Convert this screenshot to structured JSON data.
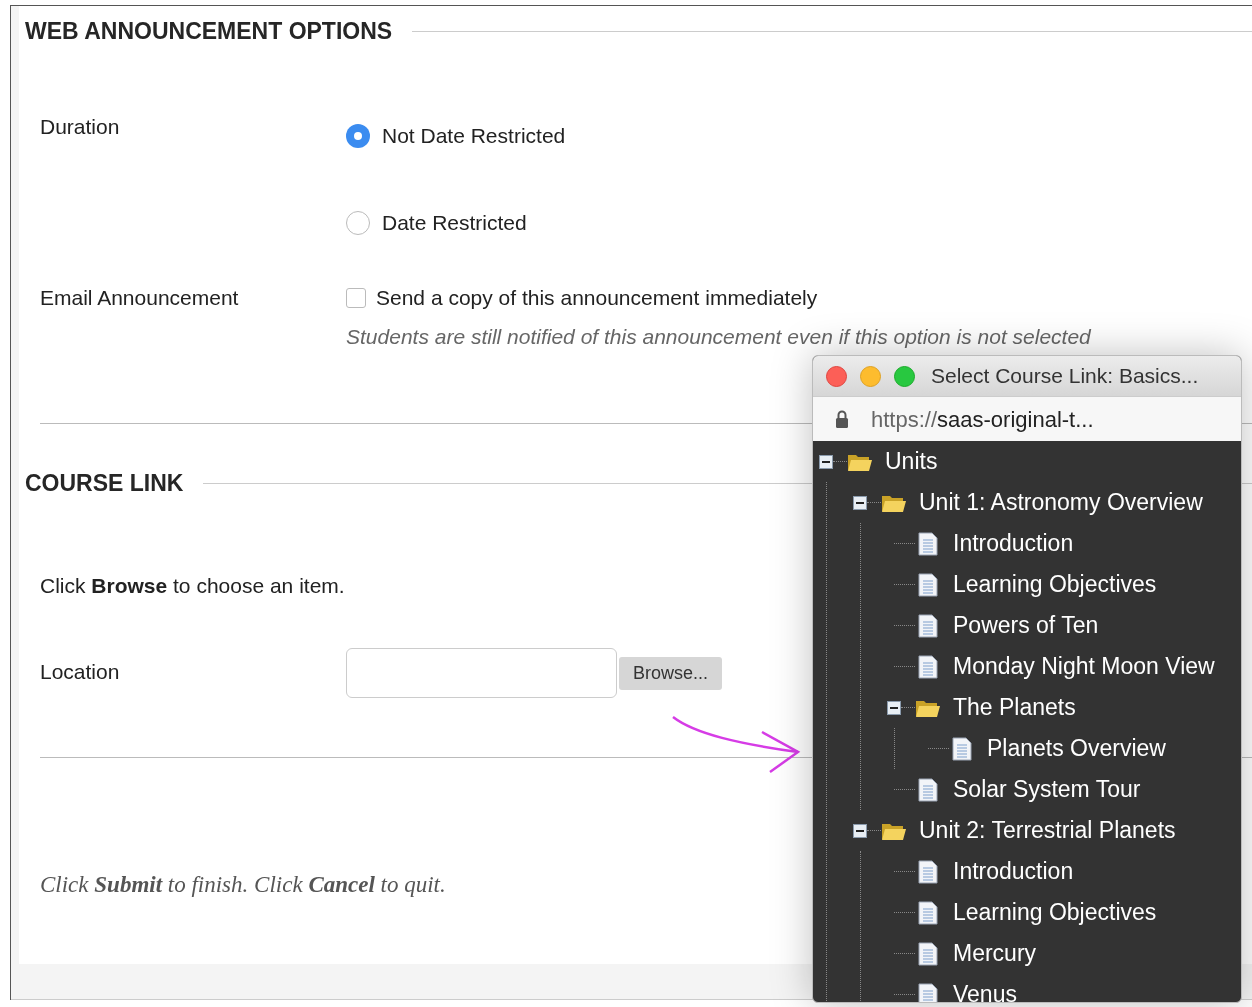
{
  "announcement_options": {
    "heading": "WEB ANNOUNCEMENT OPTIONS",
    "duration": {
      "label": "Duration",
      "options": [
        {
          "label": "Not Date Restricted",
          "selected": true
        },
        {
          "label": "Date Restricted",
          "selected": false
        }
      ]
    },
    "email": {
      "label": "Email Announcement",
      "checkbox": {
        "label": "Send a copy of this announcement immediately",
        "checked": false
      },
      "hint": "Students are still notified of this announcement even if this option is not selected"
    }
  },
  "course_link": {
    "heading": "COURSE LINK",
    "instruction": "Click **Browse** to choose an item.",
    "location": {
      "label": "Location",
      "browse_button": "Browse..."
    }
  },
  "footer_note": "Click **Submit** to finish. Click **Cancel** to quit.",
  "popup": {
    "title": "Select Course Link: Basics...",
    "url_scheme": "https://",
    "url_rest": "saas-original-t...",
    "tree": [
      {
        "label": "Units",
        "kind": "folder",
        "expanded": true,
        "children": [
          {
            "label": "Unit 1: Astronomy Overview",
            "kind": "folder",
            "expanded": true,
            "children": [
              {
                "label": "Introduction",
                "kind": "page"
              },
              {
                "label": "Learning Objectives",
                "kind": "page"
              },
              {
                "label": "Powers of Ten",
                "kind": "page"
              },
              {
                "label": "Monday Night Moon View",
                "kind": "page"
              },
              {
                "label": "The Planets",
                "kind": "folder",
                "expanded": true,
                "children": [
                  {
                    "label": "Planets Overview",
                    "kind": "page"
                  }
                ]
              },
              {
                "label": "Solar System Tour",
                "kind": "page"
              }
            ]
          },
          {
            "label": "Unit 2: Terrestrial Planets",
            "kind": "folder",
            "expanded": true,
            "children": [
              {
                "label": "Introduction",
                "kind": "page"
              },
              {
                "label": "Learning Objectives",
                "kind": "page"
              },
              {
                "label": "Mercury",
                "kind": "page"
              },
              {
                "label": "Venus",
                "kind": "page"
              }
            ]
          }
        ]
      }
    ]
  }
}
